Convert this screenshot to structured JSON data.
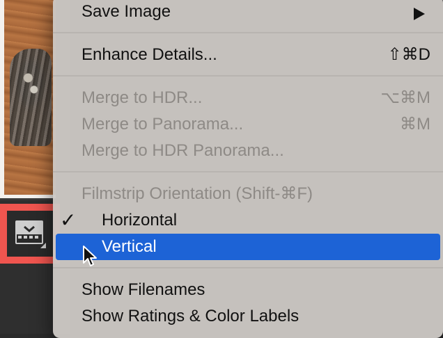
{
  "menu": {
    "save_image": "Save Image",
    "enhance_details": "Enhance Details...",
    "enhance_details_shortcut": "⇧⌘D",
    "merge_hdr": "Merge to HDR...",
    "merge_hdr_shortcut": "⌥⌘M",
    "merge_panorama": "Merge to Panorama...",
    "merge_panorama_shortcut": "⌘M",
    "merge_hdr_panorama": "Merge to HDR Panorama...",
    "filmstrip_orientation": "Filmstrip Orientation (Shift-⌘F)",
    "horizontal": "Horizontal",
    "horizontal_check": "✓",
    "vertical": "Vertical",
    "show_filenames": "Show Filenames",
    "show_ratings": "Show Ratings & Color Labels"
  },
  "colors": {
    "selection": "#1d63d6",
    "highlight_box": "#f0554f"
  },
  "icons": {
    "submenu": "submenu-arrow-icon",
    "check": "checkmark-icon",
    "orientation": "filmstrip-orientation-icon",
    "cursor": "mouse-pointer-icon"
  }
}
